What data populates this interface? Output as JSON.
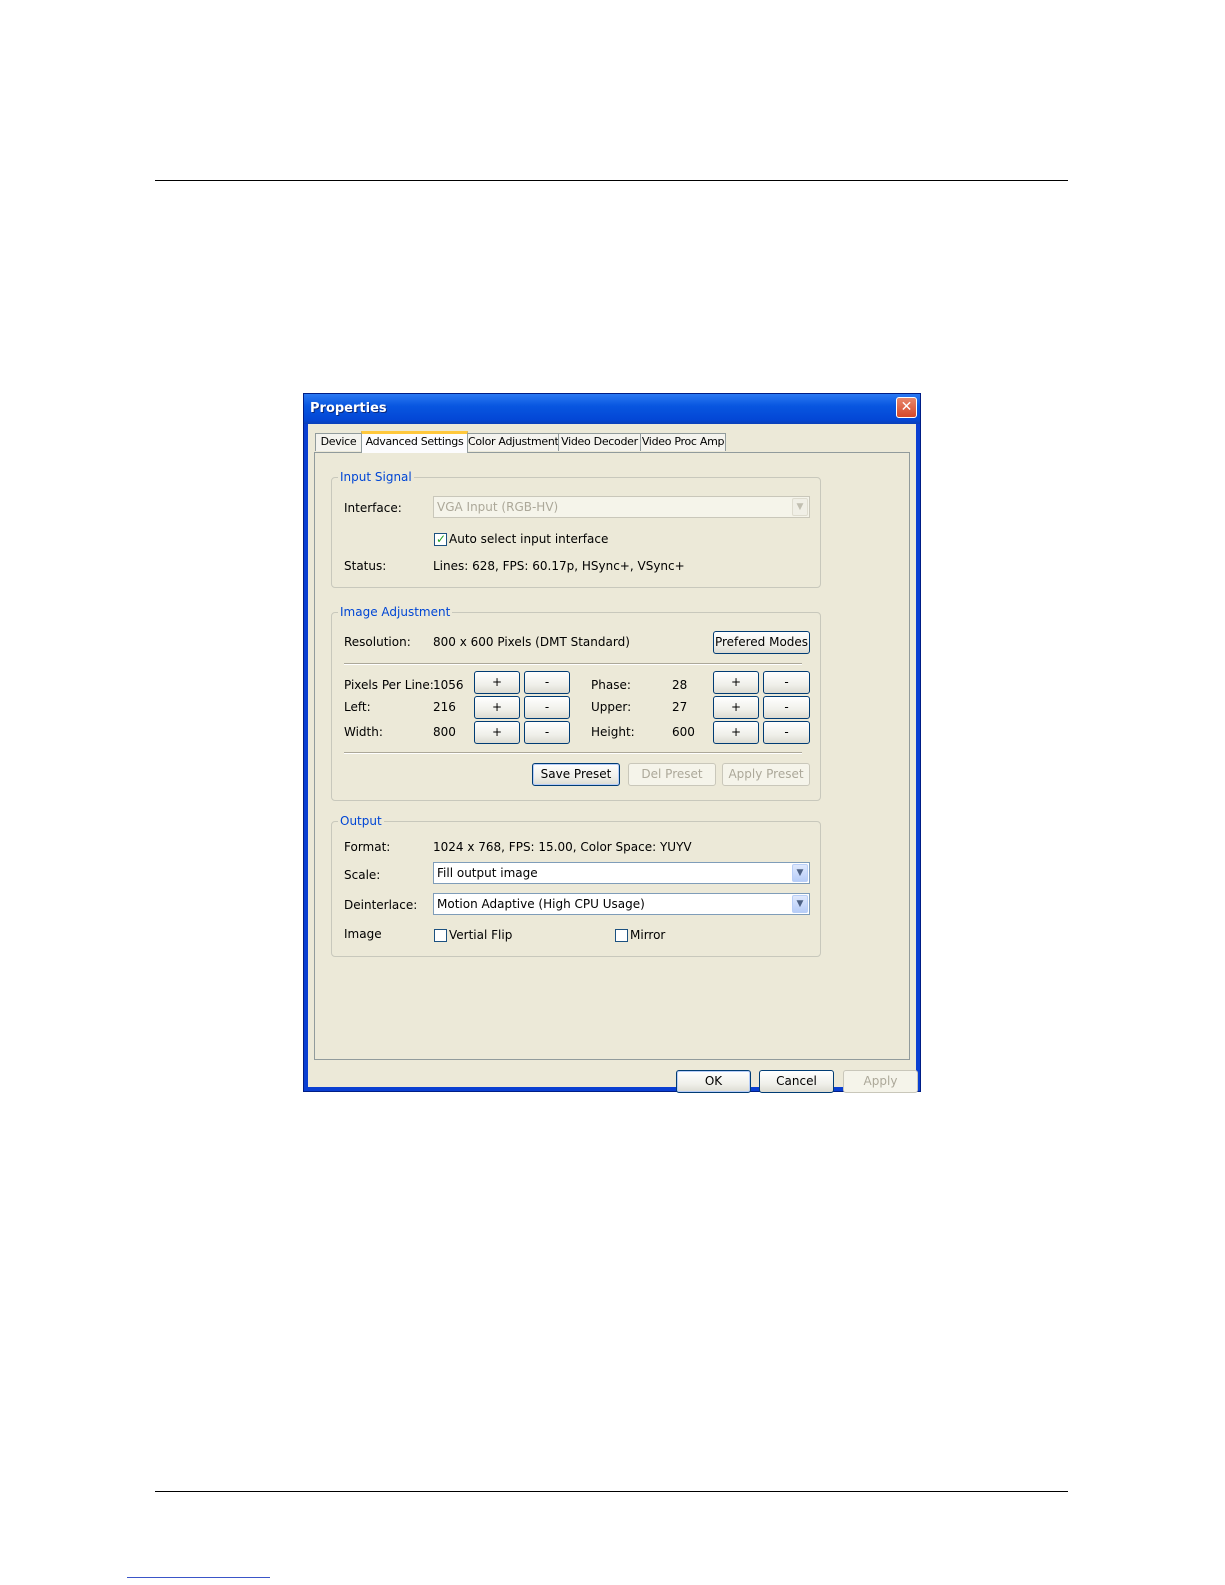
{
  "window": {
    "title": "Properties",
    "close_glyph": "✕"
  },
  "tabs": [
    {
      "label": "Device"
    },
    {
      "label": "Advanced Settings"
    },
    {
      "label": "Color Adjustment"
    },
    {
      "label": "Video Decoder"
    },
    {
      "label": "Video Proc Amp"
    }
  ],
  "active_tab": "Advanced Settings",
  "input_signal": {
    "legend": "Input Signal",
    "interface_label": "Interface:",
    "interface_value": "VGA Input (RGB-HV)",
    "auto_select_label": "Auto select input interface",
    "auto_select_checked": true,
    "status_label": "Status:",
    "status_value": "Lines: 628, FPS: 60.17p, HSync+, VSync+"
  },
  "image_adjustment": {
    "legend": "Image Adjustment",
    "resolution_label": "Resolution:",
    "resolution_value": "800 x 600 Pixels (DMT Standard)",
    "prefered_modes_button": "Prefered Modes",
    "pixels_per_line_label": "Pixels Per Line:",
    "pixels_per_line_value": "1056",
    "left_label": "Left:",
    "left_value": "216",
    "width_label": "Width:",
    "width_value": "800",
    "phase_label": "Phase:",
    "phase_value": "28",
    "upper_label": "Upper:",
    "upper_value": "27",
    "height_label": "Height:",
    "height_value": "600",
    "plus": "+",
    "minus": "-",
    "save_preset_button": "Save Preset",
    "del_preset_button": "Del Preset",
    "apply_preset_button": "Apply Preset"
  },
  "output": {
    "legend": "Output",
    "format_label": "Format:",
    "format_value": "1024 x 768, FPS: 15.00, Color Space: YUYV",
    "scale_label": "Scale:",
    "scale_value": "Fill output image",
    "deinterlace_label": "Deinterlace:",
    "deinterlace_value": "Motion Adaptive (High CPU Usage)",
    "image_label": "Image",
    "vertical_flip_label": "Vertial Flip",
    "vertical_flip_checked": false,
    "mirror_label": "Mirror",
    "mirror_checked": false
  },
  "footer_buttons": {
    "ok": "OK",
    "cancel": "Cancel",
    "apply": "Apply"
  },
  "icons": {
    "dropdown": "chevron-down-icon",
    "check": "checkmark-icon",
    "close": "close-icon"
  },
  "colors": {
    "title_bar": "#0856e0",
    "group_legend": "#0046d5",
    "dialog_bg": "#ece9d8",
    "active_tab_accent": "#ffc83c"
  }
}
